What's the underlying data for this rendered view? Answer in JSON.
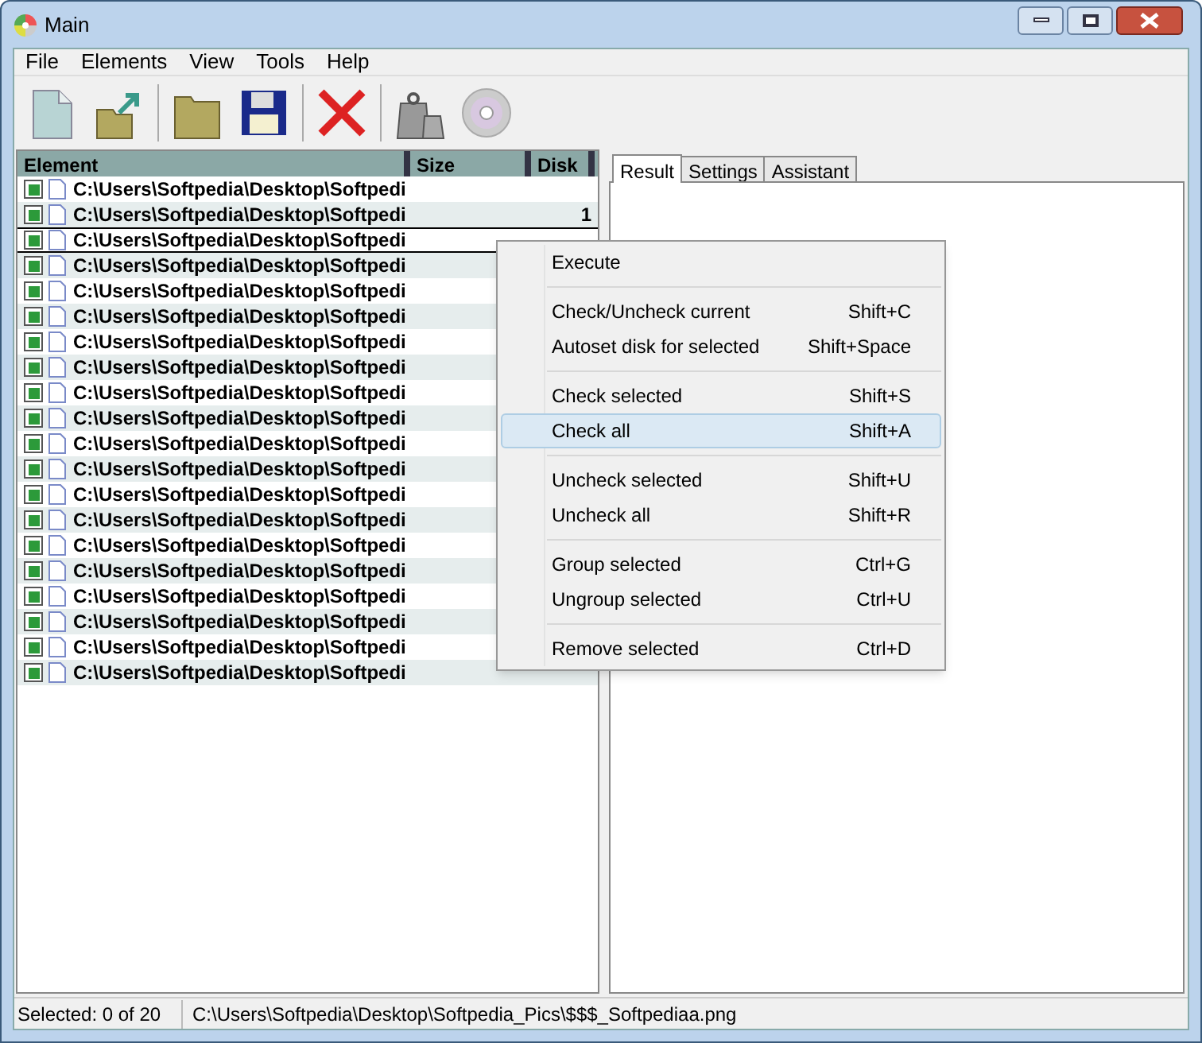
{
  "window": {
    "title": "Main"
  },
  "menu_bar": [
    "File",
    "Elements",
    "View",
    "Tools",
    "Help"
  ],
  "toolbar": [
    {
      "kind": "new"
    },
    {
      "kind": "export"
    },
    {
      "kind": "sep"
    },
    {
      "kind": "open"
    },
    {
      "kind": "save"
    },
    {
      "kind": "sep"
    },
    {
      "kind": "delete"
    },
    {
      "kind": "sep"
    },
    {
      "kind": "weights"
    },
    {
      "kind": "disc"
    }
  ],
  "table": {
    "columns": [
      "Element",
      "Size",
      "Disk"
    ],
    "rows": [
      {
        "path": "C:\\Users\\Softpedia\\Desktop\\Softpedi",
        "checked": true,
        "focused": false
      },
      {
        "path": "C:\\Users\\Softpedia\\Desktop\\Softpedi",
        "disk": "1",
        "checked": true,
        "focused": false
      },
      {
        "path": "C:\\Users\\Softpedia\\Desktop\\Softpedi",
        "checked": true,
        "focused": true
      },
      {
        "path": "C:\\Users\\Softpedia\\Desktop\\Softpedi",
        "checked": true,
        "focused": false
      },
      {
        "path": "C:\\Users\\Softpedia\\Desktop\\Softpedi",
        "checked": true,
        "focused": false
      },
      {
        "path": "C:\\Users\\Softpedia\\Desktop\\Softpedi",
        "checked": true,
        "focused": false
      },
      {
        "path": "C:\\Users\\Softpedia\\Desktop\\Softpedi",
        "checked": true,
        "focused": false
      },
      {
        "path": "C:\\Users\\Softpedia\\Desktop\\Softpedi",
        "checked": true,
        "focused": false
      },
      {
        "path": "C:\\Users\\Softpedia\\Desktop\\Softpedi",
        "checked": true,
        "focused": false
      },
      {
        "path": "C:\\Users\\Softpedia\\Desktop\\Softpedi",
        "checked": true,
        "focused": false
      },
      {
        "path": "C:\\Users\\Softpedia\\Desktop\\Softpedi",
        "checked": true,
        "focused": false
      },
      {
        "path": "C:\\Users\\Softpedia\\Desktop\\Softpedi",
        "checked": true,
        "focused": false
      },
      {
        "path": "C:\\Users\\Softpedia\\Desktop\\Softpedi",
        "checked": true,
        "focused": false
      },
      {
        "path": "C:\\Users\\Softpedia\\Desktop\\Softpedi",
        "checked": true,
        "focused": false
      },
      {
        "path": "C:\\Users\\Softpedia\\Desktop\\Softpedi",
        "checked": true,
        "focused": false
      },
      {
        "path": "C:\\Users\\Softpedia\\Desktop\\Softpedi",
        "checked": true,
        "focused": false
      },
      {
        "path": "C:\\Users\\Softpedia\\Desktop\\Softpedi",
        "checked": true,
        "focused": false
      },
      {
        "path": "C:\\Users\\Softpedia\\Desktop\\Softpedi",
        "checked": true,
        "focused": false
      },
      {
        "path": "C:\\Users\\Softpedia\\Desktop\\Softpedi",
        "checked": true,
        "focused": false
      },
      {
        "path": "C:\\Users\\Softpedia\\Desktop\\Softpedi",
        "checked": true,
        "focused": false
      }
    ]
  },
  "tabs": [
    {
      "label": "Result",
      "selected": true
    },
    {
      "label": "Settings",
      "selected": false
    },
    {
      "label": "Assistant",
      "selected": false
    }
  ],
  "context_menu": {
    "groups": [
      [
        {
          "label": "Execute",
          "selected": false
        }
      ],
      [
        {
          "label": "Check/Uncheck current",
          "shortcut": "Shift+C",
          "selected": false
        },
        {
          "label": "Autoset disk for selected",
          "shortcut": "Shift+Space",
          "selected": false
        }
      ],
      [
        {
          "label": "Check selected",
          "shortcut": "Shift+S",
          "selected": false
        },
        {
          "label": "Check all",
          "shortcut": "Shift+A",
          "selected": true
        }
      ],
      [
        {
          "label": "Uncheck selected",
          "shortcut": "Shift+U",
          "selected": false
        },
        {
          "label": "Uncheck all",
          "shortcut": "Shift+R",
          "selected": false
        }
      ],
      [
        {
          "label": "Group selected",
          "shortcut": "Ctrl+G",
          "selected": false
        },
        {
          "label": "Ungroup selected",
          "shortcut": "Ctrl+U",
          "selected": false
        }
      ],
      [
        {
          "label": "Remove selected",
          "shortcut": "Ctrl+D",
          "selected": false
        }
      ]
    ]
  },
  "status_bar": {
    "selection": "Selected: 0 of 20",
    "path": "C:\\Users\\Softpedia\\Desktop\\Softpedia_Pics\\$$$_Softpediaa.png"
  }
}
